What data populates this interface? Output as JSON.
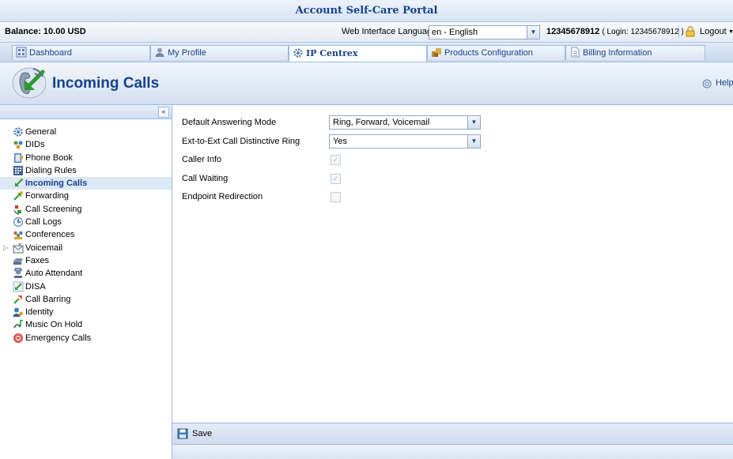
{
  "portal": {
    "title": "Account Self-Care Portal"
  },
  "infobar": {
    "balance": "Balance: 10.00 USD",
    "language_label": "Web Interface Language:",
    "language_value": "en - English",
    "account": "12345678912",
    "login_text": "( Login: 12345678912 )",
    "logout": "Logout"
  },
  "tabs": [
    {
      "label": "Dashboard",
      "icon": "dashboard-icon",
      "active": false
    },
    {
      "label": "My Profile",
      "icon": "user-icon",
      "active": false
    },
    {
      "label": "IP Centrex",
      "icon": "gear-icon",
      "active": true
    },
    {
      "label": "Products Configuration",
      "icon": "products-icon",
      "active": false
    },
    {
      "label": "Billing Information",
      "icon": "document-icon",
      "active": false
    }
  ],
  "header": {
    "title": "Incoming Calls",
    "help": "Help"
  },
  "sidebar": {
    "collapse_symbol": "«",
    "items": [
      {
        "label": "General",
        "icon": "gear-icon"
      },
      {
        "label": "DIDs",
        "icon": "dids-icon"
      },
      {
        "label": "Phone Book",
        "icon": "phone-book-icon"
      },
      {
        "label": "Dialing Rules",
        "icon": "dialing-rules-icon"
      },
      {
        "label": "Incoming Calls",
        "icon": "incoming-calls-icon",
        "active": true
      },
      {
        "label": "Forwarding",
        "icon": "forwarding-icon"
      },
      {
        "label": "Call Screening",
        "icon": "call-screening-icon"
      },
      {
        "label": "Call Logs",
        "icon": "call-logs-icon"
      },
      {
        "label": "Conferences",
        "icon": "conferences-icon"
      },
      {
        "label": "Voicemail",
        "icon": "voicemail-icon",
        "expandable": true
      },
      {
        "label": "Faxes",
        "icon": "fax-icon"
      },
      {
        "label": "Auto Attendant",
        "icon": "auto-attendant-icon"
      },
      {
        "label": "DISA",
        "icon": "disa-icon"
      },
      {
        "label": "Call Barring",
        "icon": "call-barring-icon"
      },
      {
        "label": "Identity",
        "icon": "identity-icon"
      },
      {
        "label": "Music On Hold",
        "icon": "music-on-hold-icon"
      },
      {
        "label": "Emergency Calls",
        "icon": "emergency-calls-icon"
      }
    ]
  },
  "form": {
    "answering_mode_label": "Default Answering Mode",
    "answering_mode_value": "Ring, Forward, Voicemail",
    "distinctive_ring_label": "Ext-to-Ext Call Distinctive Ring",
    "distinctive_ring_value": "Yes",
    "caller_info_label": "Caller Info",
    "caller_info_checked": true,
    "call_waiting_label": "Call Waiting",
    "call_waiting_checked": true,
    "endpoint_redirection_label": "Endpoint Redirection",
    "endpoint_redirection_checked": false
  },
  "toolbar": {
    "save_label": "Save"
  },
  "colors": {
    "accent": "#15428b",
    "border": "#99bbe8",
    "active_bg": "#dde8f5"
  }
}
